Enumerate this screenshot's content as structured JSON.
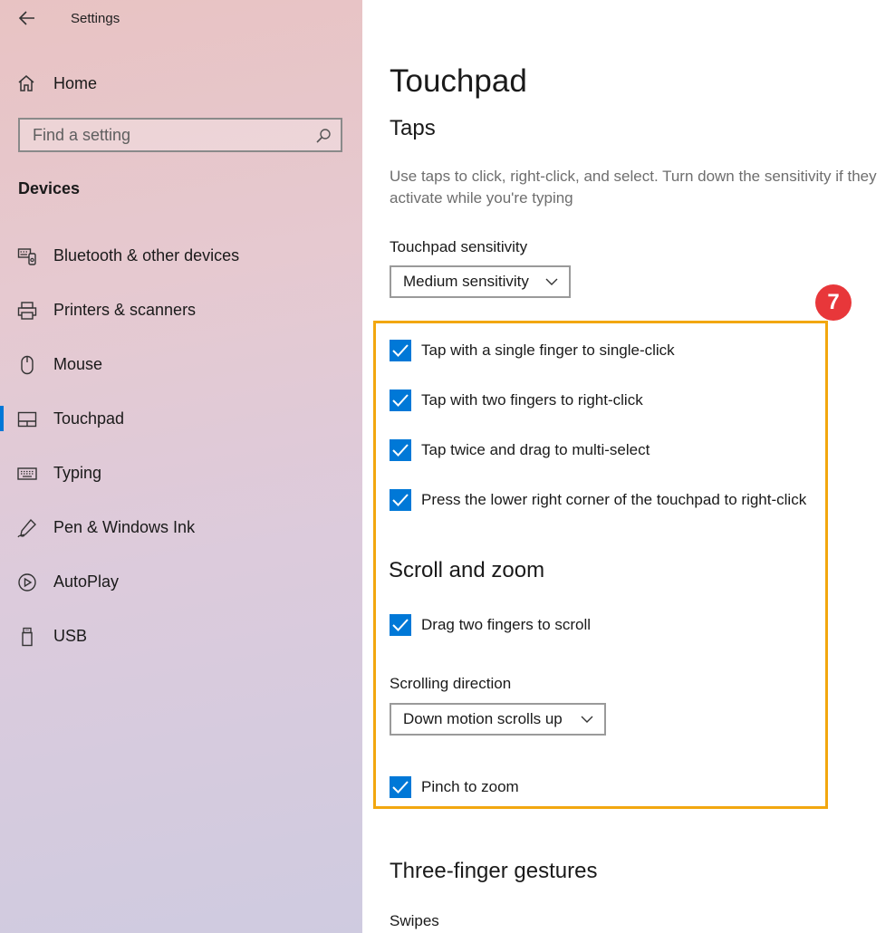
{
  "app": {
    "title": "Settings"
  },
  "sidebar": {
    "home_label": "Home",
    "search_placeholder": "Find a setting",
    "section_title": "Devices",
    "items": [
      {
        "label": "Bluetooth & other devices",
        "icon": "bluetooth-devices-icon"
      },
      {
        "label": "Printers & scanners",
        "icon": "printer-icon"
      },
      {
        "label": "Mouse",
        "icon": "mouse-icon"
      },
      {
        "label": "Touchpad",
        "icon": "touchpad-icon",
        "active": true
      },
      {
        "label": "Typing",
        "icon": "keyboard-icon"
      },
      {
        "label": "Pen & Windows Ink",
        "icon": "pen-icon"
      },
      {
        "label": "AutoPlay",
        "icon": "autoplay-icon"
      },
      {
        "label": "USB",
        "icon": "usb-icon"
      }
    ]
  },
  "main": {
    "title": "Touchpad",
    "taps": {
      "heading": "Taps",
      "description": "Use taps to click, right-click, and select. Turn down the sensitivity if they activate while you're typing",
      "sensitivity_label": "Touchpad sensitivity",
      "sensitivity_value": "Medium sensitivity",
      "options": [
        {
          "label": "Tap with a single finger to single-click",
          "checked": true
        },
        {
          "label": "Tap with two fingers to right-click",
          "checked": true
        },
        {
          "label": "Tap twice and drag to multi-select",
          "checked": true
        },
        {
          "label": "Press the lower right corner of the touchpad to right-click",
          "checked": true
        }
      ]
    },
    "scroll": {
      "heading": "Scroll and zoom",
      "drag_label": "Drag two fingers to scroll",
      "direction_label": "Scrolling direction",
      "direction_value": "Down motion scrolls up",
      "pinch_label": "Pinch to zoom"
    },
    "three_finger": {
      "heading": "Three-finger gestures",
      "swipes_label": "Swipes"
    }
  },
  "annotation": {
    "badge": "7",
    "highlight_color": "#f2a70f",
    "badge_color": "#e8373a"
  },
  "accent": "#0078d7"
}
